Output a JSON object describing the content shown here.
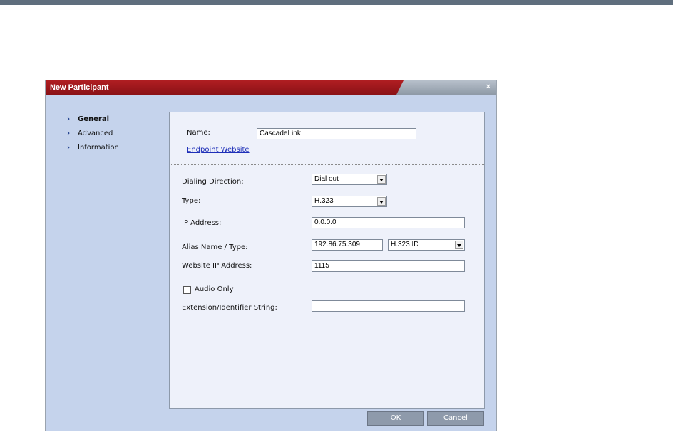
{
  "dialog": {
    "title": "New Participant",
    "close_glyph": "×",
    "nav": [
      {
        "label": "General"
      },
      {
        "label": "Advanced"
      },
      {
        "label": "Information"
      }
    ],
    "nav_arrow": "›",
    "form": {
      "name_label": "Name:",
      "name_value": "CascadeLink",
      "endpoint_link": "Endpoint Website",
      "dialing_direction_label": "Dialing Direction:",
      "dialing_direction_value": "Dial out",
      "type_label": "Type:",
      "type_value": "H.323",
      "ip_label": "IP Address:",
      "ip_value": "0.0.0.0",
      "alias_label": "Alias Name / Type:",
      "alias_value": "192.86.75.309",
      "alias_type_value": "H.323 ID",
      "website_ip_label": "Website IP Address:",
      "website_ip_value": "1115",
      "audio_only_label": "Audio Only",
      "audio_only_checked": false,
      "extension_label": "Extension/Identifier String:",
      "extension_value": ""
    },
    "buttons": {
      "ok": "OK",
      "cancel": "Cancel"
    }
  },
  "colors": {
    "title_bar": "#a0181d",
    "dialog_bg": "#c5d3ec",
    "panel_bg": "#eef1fa",
    "button_bg": "#8e9aab",
    "link": "#1e2fb8"
  }
}
